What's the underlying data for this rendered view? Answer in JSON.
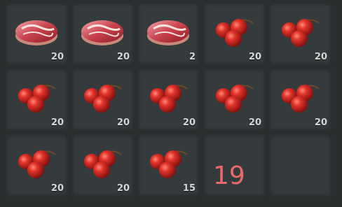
{
  "inventory": {
    "slots": [
      {
        "item": "steak-icon",
        "qty": "20"
      },
      {
        "item": "steak-icon",
        "qty": "20"
      },
      {
        "item": "steak-icon",
        "qty": "2"
      },
      {
        "item": "berries-icon",
        "qty": "20"
      },
      {
        "item": "berries-icon",
        "qty": "20"
      },
      {
        "item": "berries-icon",
        "qty": "20"
      },
      {
        "item": "berries-icon",
        "qty": "20"
      },
      {
        "item": "berries-icon",
        "qty": "20"
      },
      {
        "item": "berries-icon",
        "qty": "20"
      },
      {
        "item": "berries-icon",
        "qty": "20"
      },
      {
        "item": "berries-icon",
        "qty": "20"
      },
      {
        "item": "berries-icon",
        "qty": "20"
      },
      {
        "item": "berries-icon",
        "qty": "15"
      },
      {
        "item": null,
        "qty": ""
      },
      {
        "item": null,
        "qty": ""
      }
    ]
  },
  "overlay_text": "19"
}
